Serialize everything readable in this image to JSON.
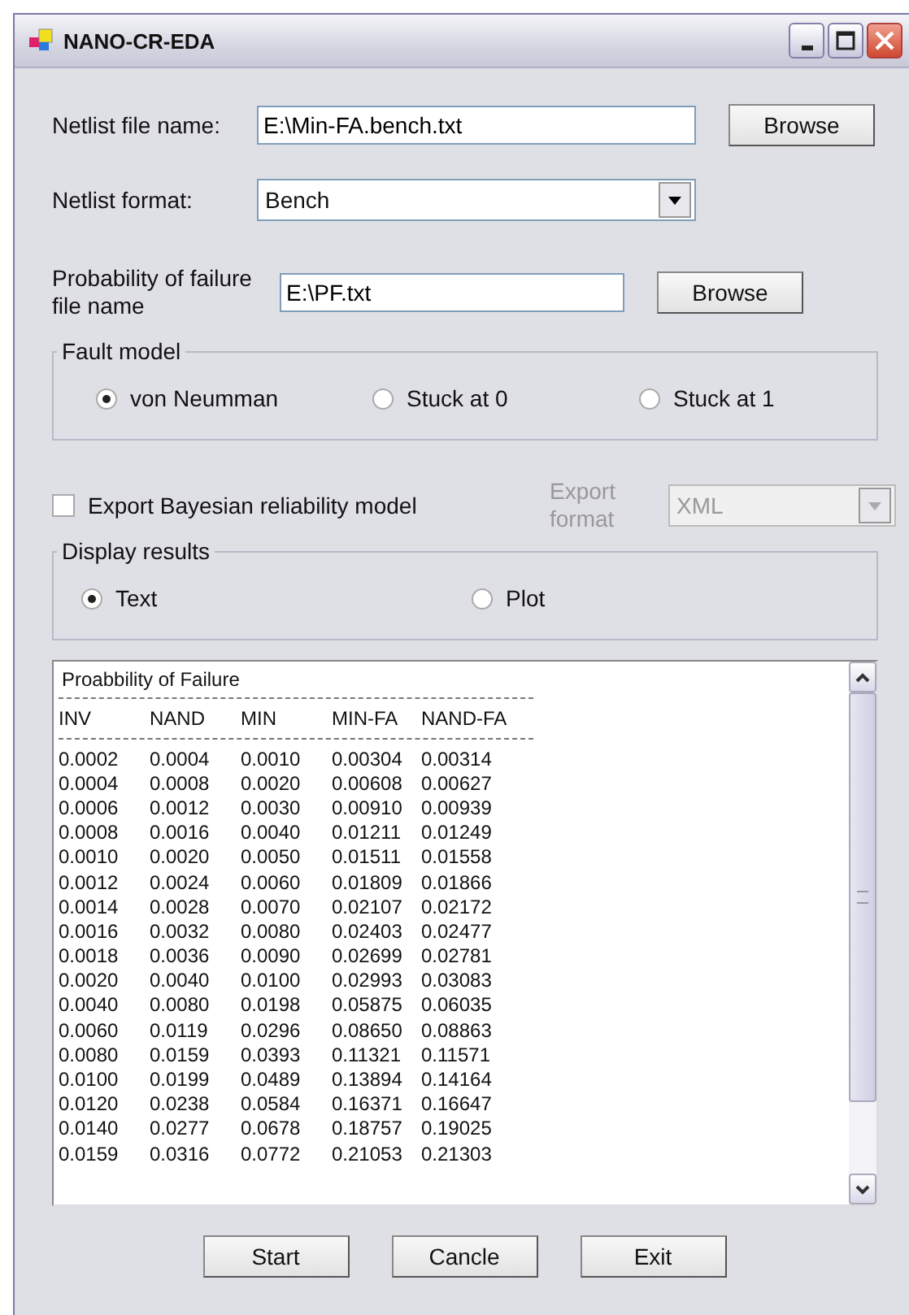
{
  "window": {
    "title": "NANO-CR-EDA"
  },
  "netlist_file": {
    "label": "Netlist file name:",
    "value": "E:\\Min-FA.bench.txt",
    "button": "Browse"
  },
  "netlist_format": {
    "label": "Netlist format:",
    "value": "Bench"
  },
  "failure_file": {
    "label": "Probability of failure file name",
    "value": "E:\\PF.txt",
    "button": "Browse"
  },
  "fault_model": {
    "title": "Fault model",
    "options": [
      {
        "label": "von Neumman",
        "selected": true
      },
      {
        "label": "Stuck at 0",
        "selected": false
      },
      {
        "label": "Stuck at 1",
        "selected": false
      }
    ]
  },
  "export": {
    "label": "Export Bayesian reliability model",
    "checked": false,
    "format_label": "Export format",
    "format_value": "XML",
    "disabled": true
  },
  "display_results": {
    "title": "Display results",
    "options": [
      {
        "label": "Text",
        "selected": true
      },
      {
        "label": "Plot",
        "selected": false
      }
    ]
  },
  "output": {
    "title": "Proabbility of Failure",
    "columns": [
      "INV",
      "NAND",
      "MIN",
      "MIN-FA",
      "NAND-FA"
    ],
    "rows": [
      [
        "0.0002",
        "0.0004",
        "0.0010",
        "0.00304",
        "0.00314"
      ],
      [
        "0.0004",
        "0.0008",
        "0.0020",
        "0.00608",
        "0.00627"
      ],
      [
        "0.0006",
        "0.0012",
        "0.0030",
        "0.00910",
        "0.00939"
      ],
      [
        "0.0008",
        "0.0016",
        "0.0040",
        "0.01211",
        "0.01249"
      ],
      [
        "0.0010",
        "0.0020",
        "0.0050",
        "0.01511",
        "0.01558"
      ],
      [
        "0.0012",
        "0.0024",
        "0.0060",
        "0.01809",
        "0.01866"
      ],
      [
        "0.0014",
        "0.0028",
        "0.0070",
        "0.02107",
        "0.02172"
      ],
      [
        "0.0016",
        "0.0032",
        "0.0080",
        "0.02403",
        "0.02477"
      ],
      [
        "0.0018",
        "0.0036",
        "0.0090",
        "0.02699",
        "0.02781"
      ],
      [
        "0.0020",
        "0.0040",
        "0.0100",
        "0.02993",
        "0.03083"
      ],
      [
        "0.0040",
        "0.0080",
        "0.0198",
        "0.05875",
        "0.06035"
      ],
      [
        "0.0060",
        "0.0119",
        "0.0296",
        "0.08650",
        "0.08863"
      ],
      [
        "0.0080",
        "0.0159",
        "0.0393",
        "0.11321",
        "0.11571"
      ],
      [
        "0.0100",
        "0.0199",
        "0.0489",
        "0.13894",
        "0.14164"
      ],
      [
        "0.0120",
        "0.0238",
        "0.0584",
        "0.16371",
        "0.16647"
      ],
      [
        "0.0140",
        "0.0277",
        "0.0678",
        "0.18757",
        "0.19025"
      ],
      [
        "0.0159",
        "0.0316",
        "0.0772",
        "0.21053",
        "0.21303"
      ]
    ]
  },
  "buttons": [
    "Start",
    "Cancle",
    "Exit"
  ]
}
